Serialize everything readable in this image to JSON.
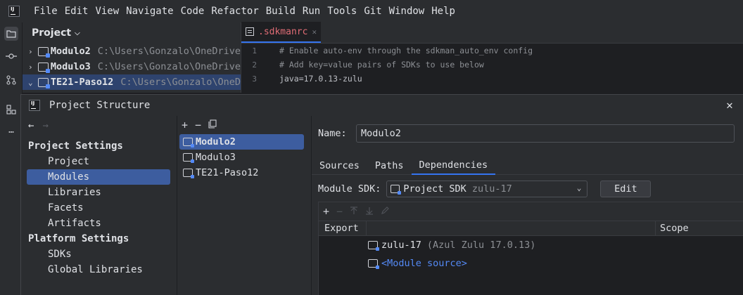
{
  "menu": [
    "File",
    "Edit",
    "View",
    "Navigate",
    "Code",
    "Refactor",
    "Build",
    "Run",
    "Tools",
    "Git",
    "Window",
    "Help"
  ],
  "app_logo_text": "IJ",
  "project_panel": {
    "title": "Project",
    "items": [
      {
        "name": "Modulo2",
        "path": "C:\\Users\\Gonzalo\\OneDrive"
      },
      {
        "name": "Modulo3",
        "path": "C:\\Users\\Gonzalo\\OneDrive"
      },
      {
        "name": "TE21-Paso12",
        "path": "C:\\Users\\Gonzalo\\OneD"
      }
    ]
  },
  "editor": {
    "tab": ".sdkmanrc",
    "lines": [
      {
        "n": "1",
        "text": "# Enable auto-env through the sdkman_auto_env config"
      },
      {
        "n": "2",
        "text": "# Add key=value pairs of SDKs to use below"
      },
      {
        "n": "3",
        "text": "java=17.0.13-zulu"
      }
    ]
  },
  "dialog": {
    "title": "Project Structure",
    "close": "✕",
    "nav_back": "←",
    "nav_fwd": "→",
    "project_settings_head": "Project Settings",
    "project_settings": [
      "Project",
      "Modules",
      "Libraries",
      "Facets",
      "Artifacts"
    ],
    "platform_settings_head": "Platform Settings",
    "platform_settings": [
      "SDKs",
      "Global Libraries"
    ],
    "modules": [
      "Modulo2",
      "Modulo3",
      "TE21-Paso12"
    ],
    "name_label": "Name:",
    "name_value": "Modulo2",
    "tabs": [
      "Sources",
      "Paths",
      "Dependencies"
    ],
    "sdk_label": "Module SDK:",
    "sdk_main": "Project SDK",
    "sdk_sub": "zulu-17",
    "edit_button": "Edit",
    "dep_head_export": "Export",
    "dep_head_scope": "Scope",
    "dependencies": [
      {
        "name": "zulu-17",
        "extra": "(Azul Zulu 17.0.13)"
      },
      {
        "name": "<Module source>",
        "extra": ""
      }
    ]
  }
}
